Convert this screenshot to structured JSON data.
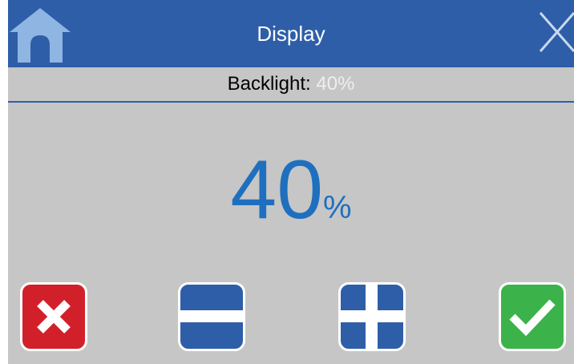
{
  "header": {
    "title": "Display",
    "home_icon": "home-icon",
    "close_icon": "close-icon"
  },
  "status": {
    "label": "Backlight:",
    "value": "40%"
  },
  "setting": {
    "value": "40",
    "unit": "%"
  },
  "controls": {
    "cancel_icon": "cancel-x-icon",
    "decrease_icon": "minus-icon",
    "increase_icon": "plus-icon",
    "confirm_icon": "checkmark-icon"
  },
  "colors": {
    "title_bar": "#2f5ea8",
    "background": "#c6c6c6",
    "value_text": "#1f6fbf",
    "cancel": "#d2202a",
    "adjust": "#2f5ea8",
    "confirm": "#3bb34a",
    "home_icon": "#8fb5e3"
  }
}
